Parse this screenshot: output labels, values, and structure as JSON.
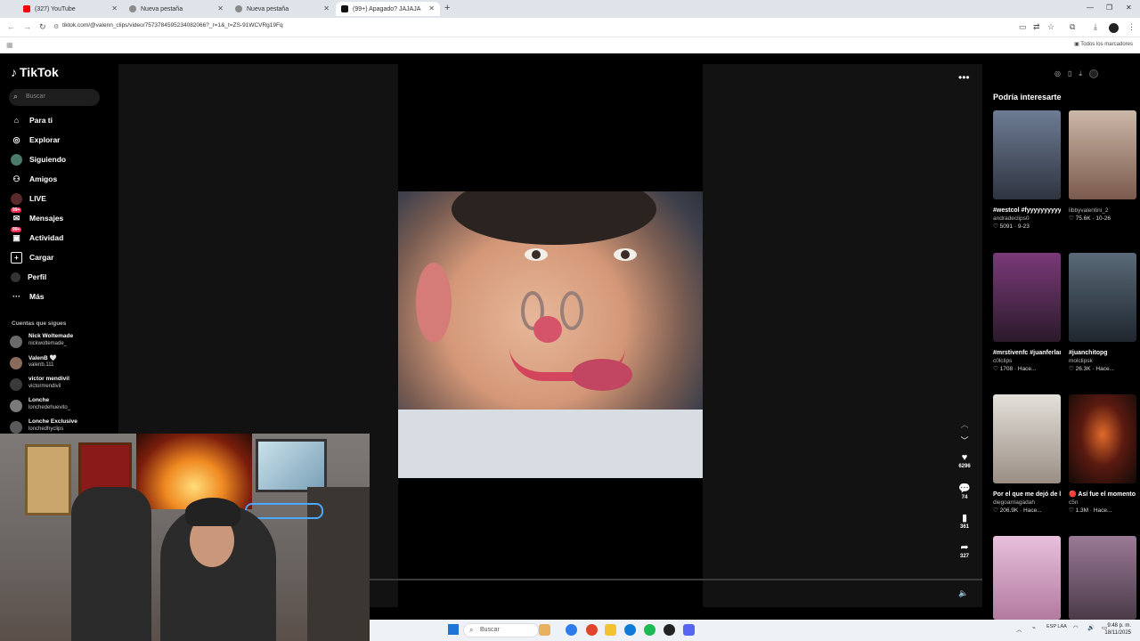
{
  "browser": {
    "tabs": [
      {
        "title": "(327) YouTube",
        "favicon_color": "#ff0000"
      },
      {
        "title": "Nueva pestaña",
        "favicon_color": "#8a8a8a"
      },
      {
        "title": "Nueva pestaña",
        "favicon_color": "#8a8a8a"
      },
      {
        "title": "(99+) Apagado? JAJAJA",
        "favicon_color": "#111111"
      }
    ],
    "new_tab": "+",
    "url": "tiktok.com/@valenn_clips/video/7573784595234082066?_r=1&_t=ZS-91WCVRg19Fq",
    "bookmarks_label": "Todos los marcadores"
  },
  "tiktok": {
    "logo": "TikTok",
    "search_placeholder": "Buscar",
    "menu": [
      {
        "label": "Para ti",
        "icon": "home-icon"
      },
      {
        "label": "Explorar",
        "icon": "compass-icon"
      },
      {
        "label": "Siguiendo",
        "icon": "following-icon"
      },
      {
        "label": "Amigos",
        "icon": "friends-icon"
      },
      {
        "label": "LIVE",
        "icon": "live-icon"
      },
      {
        "label": "Mensajes",
        "icon": "messages-icon",
        "badge": "99+"
      },
      {
        "label": "Actividad",
        "icon": "activity-icon",
        "badge": "99+"
      },
      {
        "label": "Cargar",
        "icon": "upload-icon"
      },
      {
        "label": "Perfil",
        "icon": "profile-icon"
      },
      {
        "label": "Más",
        "icon": "more-icon"
      }
    ],
    "following_title": "Cuentas que sigues",
    "following": [
      {
        "name": "Nick Woltemade",
        "handle": "nickwoltemade_"
      },
      {
        "name": "ValenB 🤍",
        "handle": "valenb.111"
      },
      {
        "name": "victor mendivil",
        "handle": "victormendivil"
      },
      {
        "name": "Lonche",
        "handle": "lonchedehuevito_"
      },
      {
        "name": "Lonche Exclusive",
        "handle": "lonchedhyclips"
      }
    ],
    "actions": {
      "likes": "6296",
      "comments": "74",
      "saves": "361",
      "shares": "327"
    },
    "recommendations_title": "Podría interesarte",
    "recommendations": [
      {
        "caption": "#westcol #fyyyyyyyyyyyyy...",
        "author": "andradeclips0",
        "stats": "♡ 5091 · 9-23",
        "color": "#5b6c86"
      },
      {
        "caption": "",
        "author": "libbyvalentini_2",
        "stats": "♡ 75.6K · 10-26",
        "color": "#b49a8c"
      },
      {
        "caption": "#mrstivenfc #juanferlamata",
        "author": "c0lclips",
        "stats": "♡ 1708 · Hace...",
        "color": "#5a3a58"
      },
      {
        "caption": "#juanchitopg",
        "author": "molclipsk",
        "stats": "♡ 26.3K · Hace...",
        "color": "#3f4a57"
      },
      {
        "caption": "Por el que me dejó de lado #fyp",
        "author": "diegoarriagadah",
        "stats": "♡ 206.9K · Hace...",
        "color": "#cfc9c2"
      },
      {
        "caption": "🔴 Así fue el momento de la...",
        "author": "c5n",
        "stats": "♡ 1.3M · Hace...",
        "color": "#3a2418"
      },
      {
        "caption": "",
        "author": "",
        "stats": "",
        "color": "#d8a8c8"
      },
      {
        "caption": "",
        "author": "",
        "stats": "",
        "color": "#8a6a86"
      }
    ]
  },
  "taskbar": {
    "search": "Buscar",
    "lang": "ESP LAA",
    "time": "9:48 p. m.",
    "date": "18/11/2025"
  }
}
